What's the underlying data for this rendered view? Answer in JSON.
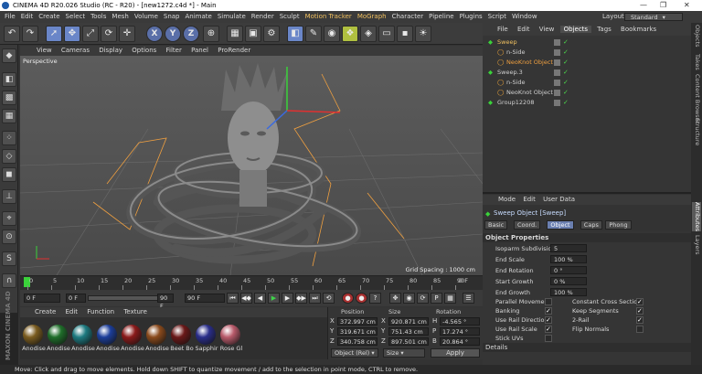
{
  "titlebar": {
    "title": "CINEMA 4D R20.026 Studio (RC - R20) - [new1272.c4d *] - Main",
    "minimize": "—",
    "maximize": "❐",
    "close": "✕"
  },
  "menubar": {
    "items": [
      "File",
      "Edit",
      "Create",
      "Select",
      "Tools",
      "Mesh",
      "Volume",
      "Snap",
      "Animate",
      "Simulate",
      "Render",
      "Sculpt",
      "Motion Tracker",
      "MoGraph",
      "Character",
      "Pipeline",
      "Plugins",
      "Script",
      "Window"
    ],
    "layout_label": "Layout:",
    "layout_value": "Standard"
  },
  "viewport": {
    "menu": [
      "View",
      "Cameras",
      "Display",
      "Options",
      "Filter",
      "Panel",
      "ProRender"
    ],
    "label": "Perspective",
    "grid_spacing": "Grid Spacing : 1000 cm"
  },
  "timeline": {
    "ticks": [
      "0",
      "5",
      "10",
      "15",
      "20",
      "25",
      "30",
      "35",
      "40",
      "45",
      "50",
      "55",
      "60",
      "65",
      "70",
      "75",
      "80",
      "85",
      "90"
    ],
    "end_label": "0 F"
  },
  "transport": {
    "current": "0 F",
    "start": "0 F",
    "end": "90 F",
    "max": "90 F"
  },
  "materials": {
    "menu": [
      "Create",
      "Edit",
      "Function",
      "Texture"
    ],
    "items": [
      {
        "name": "Anodise",
        "color": "#7a5c20"
      },
      {
        "name": "Anodise",
        "color": "#1f6e2a"
      },
      {
        "name": "Anodise",
        "color": "#1d7a80"
      },
      {
        "name": "Anodise",
        "color": "#1c3e9a"
      },
      {
        "name": "Anodise",
        "color": "#8a1a1a"
      },
      {
        "name": "Anodise",
        "color": "#8a4a1c"
      },
      {
        "name": "Beet Bo",
        "color": "#6a1818"
      },
      {
        "name": "Sapphir",
        "color": "#2a2e8a"
      },
      {
        "name": "Rose Gl",
        "color": "#b85a6a"
      }
    ]
  },
  "coordinates": {
    "headers": [
      "Position",
      "Size",
      "Rotation"
    ],
    "rows": [
      {
        "axis": "X",
        "pos": "372.997 cm",
        "size_axis": "X",
        "size": "920.871 cm",
        "rot_axis": "H",
        "rot": "-4.565 °"
      },
      {
        "axis": "Y",
        "pos": "319.671 cm",
        "size_axis": "Y",
        "size": "751.43 cm",
        "rot_axis": "P",
        "rot": "17.274 °"
      },
      {
        "axis": "Z",
        "pos": "340.758 cm",
        "size_axis": "Z",
        "size": "897.501 cm",
        "rot_axis": "B",
        "rot": "20.864 °"
      }
    ],
    "mode": "Object (Rel)",
    "size_mode": "Size",
    "apply": "Apply"
  },
  "object_manager": {
    "menu": [
      "File",
      "Edit",
      "View",
      "Objects",
      "Tags",
      "Bookmarks"
    ],
    "active_tab": "Objects",
    "objects": [
      {
        "name": "Sweep",
        "indent": 0,
        "color": "#f0c060"
      },
      {
        "name": "n-Side",
        "indent": 1,
        "color": "#d0d0d0"
      },
      {
        "name": "NeoKnot Object",
        "indent": 1,
        "color": "#f0a040"
      },
      {
        "name": "Sweep.3",
        "indent": 0,
        "color": "#d0d0d0"
      },
      {
        "name": "n-Side",
        "indent": 1,
        "color": "#d0d0d0"
      },
      {
        "name": "NeoKnot Object",
        "indent": 1,
        "color": "#d0d0d0"
      },
      {
        "name": "Group12208",
        "indent": 0,
        "color": "#d0d0d0"
      }
    ]
  },
  "attributes": {
    "menu": [
      "Mode",
      "Edit",
      "User Data"
    ],
    "title": "Sweep Object [Sweep]",
    "tabs": [
      "Basic",
      "Coord.",
      "Object",
      "Caps",
      "Phong"
    ],
    "active_tab": "Object",
    "section": "Object Properties",
    "fields": [
      {
        "label": "Isoparm Subdivision",
        "value": "5"
      },
      {
        "label": "End Scale",
        "value": "100 %"
      },
      {
        "label": "End Rotation",
        "value": "0 °"
      },
      {
        "label": "Start Growth",
        "value": "0 %"
      },
      {
        "label": "End Growth",
        "value": "100 %"
      }
    ],
    "checks_left": [
      {
        "label": "Parallel Movement",
        "checked": false
      },
      {
        "label": "Banking",
        "checked": true
      },
      {
        "label": "Use Rail Direction",
        "checked": true
      },
      {
        "label": "Use Rail Scale",
        "checked": true
      },
      {
        "label": "Stick UVs",
        "checked": false
      }
    ],
    "checks_right": [
      {
        "label": "Constant Cross Section",
        "checked": true
      },
      {
        "label": "Keep Segments",
        "checked": true
      },
      {
        "label": "2-Rail",
        "checked": true
      },
      {
        "label": "Flip Normals",
        "checked": false
      }
    ],
    "details": "Details"
  },
  "right_tabs": [
    "Objects",
    "Takes",
    "Content Browser",
    "Structure",
    "Attributes",
    "Layers"
  ],
  "right_tabs_active": "Attributes",
  "statusbar": "Move: Click and drag to move elements. Hold down SHIFT to quantize movement / add to the selection in point mode, CTRL to remove.",
  "brand": "MAXON CINEMA 4D"
}
